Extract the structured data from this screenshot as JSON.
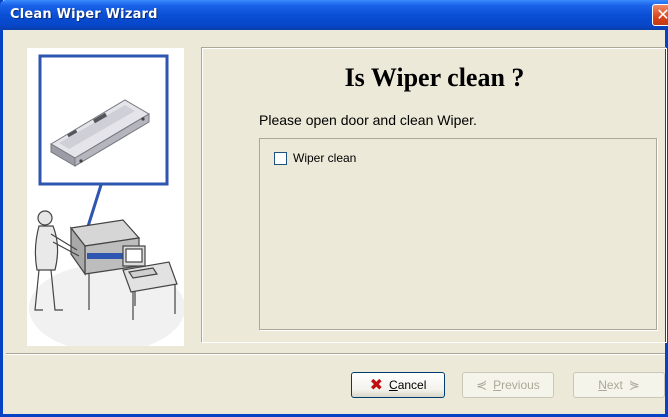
{
  "window": {
    "title": "Clean Wiper Wizard",
    "close_glyph": "✕"
  },
  "content": {
    "heading": "Is Wiper clean ?",
    "instruction": "Please open door and clean Wiper.",
    "checkbox": {
      "label": "Wiper clean",
      "checked": false
    }
  },
  "buttons": {
    "cancel": {
      "label": "Cancel",
      "icon": "red-x-icon",
      "enabled": true
    },
    "previous": {
      "label": "Previous",
      "icon": "previous-arrow-icon",
      "enabled": false
    },
    "next": {
      "label": "Next",
      "icon": "next-arrow-icon",
      "enabled": false
    }
  },
  "colors": {
    "titlebar": "#0A4FD6",
    "dialog_bg": "#ECE9D8",
    "highlight": "#2E55B0"
  }
}
